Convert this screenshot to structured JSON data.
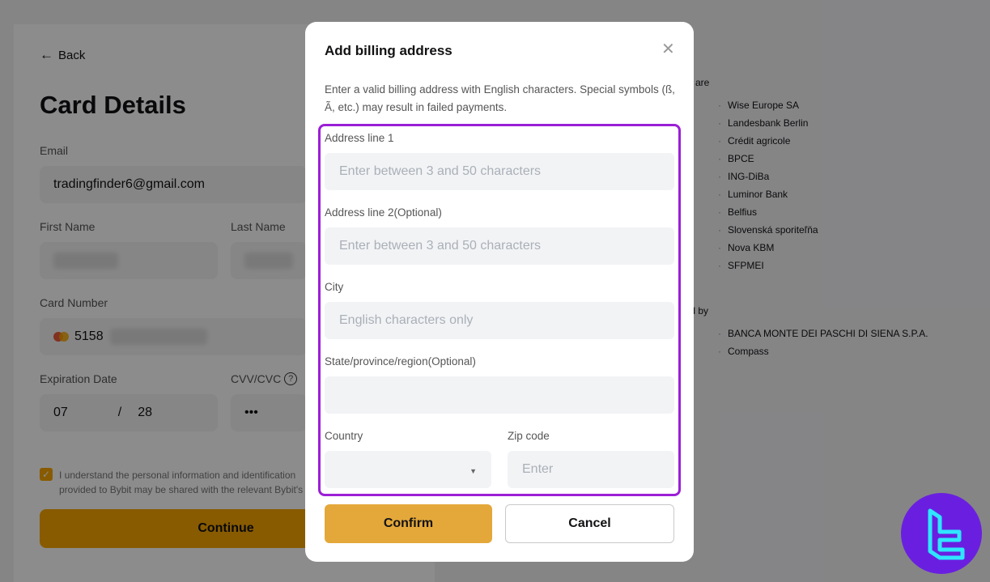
{
  "background": {
    "back_label": "Back",
    "page_title": "Card Details",
    "email_label": "Email",
    "email_value": "tradingfinder6@gmail.com",
    "first_name_label": "First Name",
    "last_name_label": "Last Name",
    "card_number_label": "Card Number",
    "card_number_prefix": "5158",
    "expiration_label": "Expiration Date",
    "exp_month": "07",
    "exp_separator": "/",
    "exp_year": "28",
    "cvv_label": "CVV/CVC",
    "cvv_value": "•••",
    "consent_text": "I understand the personal information and identification provided to Bybit may be shared with the relevant Bybit's",
    "continue_label": "Continue",
    "banks_intro_1": "ds are",
    "banks_1": [
      "Wise Europe SA",
      "Landesbank Berlin",
      "Crédit agricole",
      "BPCE",
      "ING-DiBa",
      "Luminor Bank",
      "Belfius",
      "Slovenská sporiteľňa",
      "Nova KBM",
      "SFPMEI"
    ],
    "banks_intro_2": "ied by",
    "banks_2": [
      "BANCA MONTE DEI PASCHI DI SIENA S.P.A.",
      "Compass"
    ]
  },
  "modal": {
    "title": "Add billing address",
    "description": "Enter a valid billing address with English characters. Special symbols (ß, Ã, etc.) may result in failed payments.",
    "address1_label": "Address line 1",
    "address1_placeholder": "Enter between 3 and 50 characters",
    "address2_label": "Address line 2(Optional)",
    "address2_placeholder": "Enter between 3 and 50 characters",
    "city_label": "City",
    "city_placeholder": "English characters only",
    "state_label": "State/province/region(Optional)",
    "state_placeholder": "",
    "country_label": "Country",
    "country_value": "",
    "zip_label": "Zip code",
    "zip_placeholder": "Enter",
    "confirm_label": "Confirm",
    "cancel_label": "Cancel"
  },
  "colors": {
    "accent": "#f7a600",
    "highlight_border": "#9b1fd6",
    "logo_bg": "#6a1fe0"
  }
}
